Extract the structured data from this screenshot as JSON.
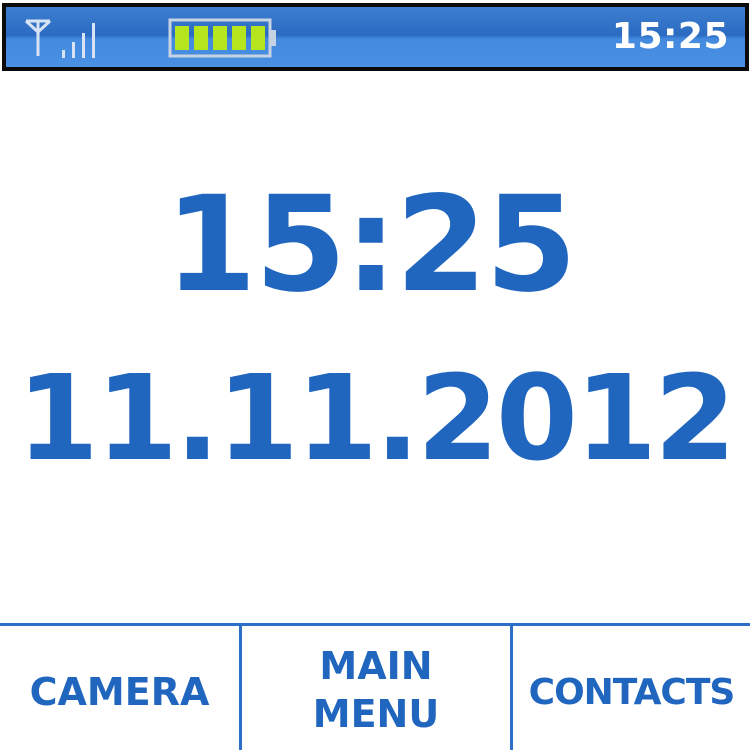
{
  "status_bar": {
    "time": "15:25",
    "signal_icon": "antenna-icon",
    "signal_strength_bars": 4,
    "battery_icon": "battery-icon",
    "battery_level_fraction": 1.0,
    "colors": {
      "bar_top": "#2b6bc2",
      "bar_bottom": "#4a90e4",
      "battery_fill": "#b5e61d",
      "icon_color": "#d8e4f4"
    }
  },
  "clock": {
    "time": "15:25",
    "date": "11.11.2012",
    "color": "#2066bf"
  },
  "softkeys": {
    "left_label": "CAMERA",
    "center_line1": "MAIN",
    "center_line2": "MENU",
    "right_label": "CONTACTS",
    "color": "#2066bf"
  }
}
